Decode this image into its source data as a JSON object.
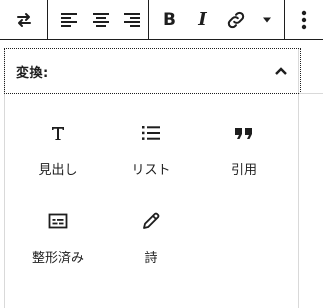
{
  "toolbar": {
    "transform_icon": "arrows-swap-icon",
    "align_left_icon": "align-left-icon",
    "align_center_icon": "align-center-icon",
    "align_right_icon": "align-right-icon",
    "bold_label": "B",
    "italic_label": "I",
    "link_icon": "link-icon",
    "more_formats_icon": "caret-down-icon",
    "options_icon": "vertical-ellipsis-icon"
  },
  "panel": {
    "title": "変換:",
    "collapse_icon": "chevron-up-icon",
    "blocks": [
      {
        "label": "見出し",
        "icon": "heading-icon"
      },
      {
        "label": "リスト",
        "icon": "list-icon"
      },
      {
        "label": "引用",
        "icon": "quote-icon"
      },
      {
        "label": "整形済み",
        "icon": "preformatted-icon"
      },
      {
        "label": "詩",
        "icon": "pencil-icon"
      }
    ]
  },
  "colors": {
    "text": "#1e1e1e",
    "border": "#1e1e1e",
    "panel_border": "#d9d9d9",
    "background": "#ffffff"
  }
}
